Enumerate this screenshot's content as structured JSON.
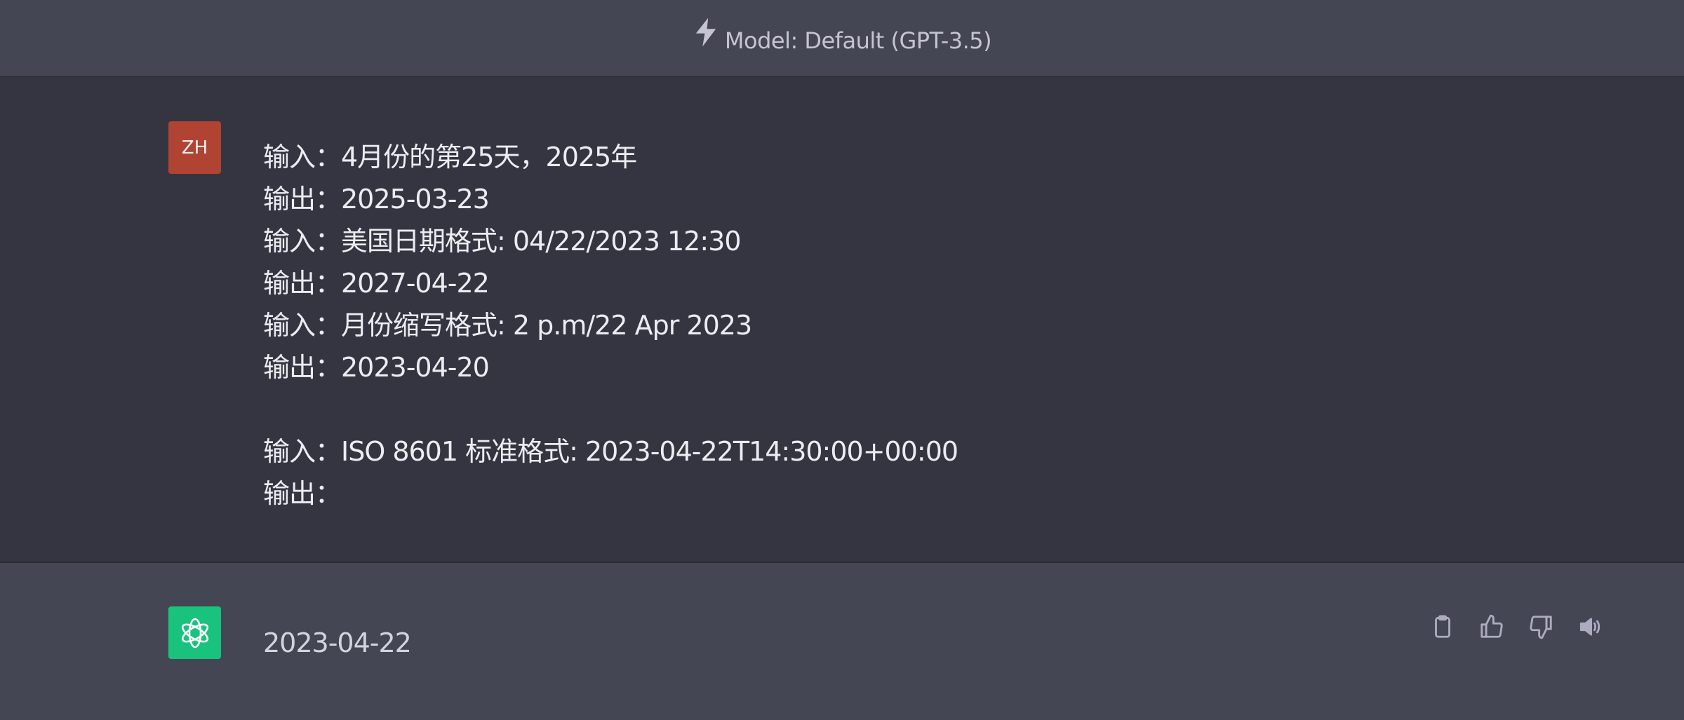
{
  "header": {
    "model_label": "Model: Default (GPT-3.5)"
  },
  "user_message": {
    "avatar_initials": "ZH",
    "lines": [
      "输入：4月份的第25天，2025年",
      "输出：2025-03-23",
      "输入：美国日期格式: 04/22/2023 12:30",
      "输出：2027-04-22",
      "输入：月份缩写格式: 2 p.m/22 Apr 2023",
      "输出：2023-04-20",
      "",
      "输入：ISO 8601 标准格式: 2023-04-22T14:30:00+00:00",
      "输出："
    ]
  },
  "assistant_message": {
    "text": "2023-04-22",
    "actions": [
      "clipboard-icon",
      "thumbs-up-icon",
      "thumbs-down-icon",
      "speaker-icon"
    ]
  },
  "colors": {
    "header_bg": "#444654",
    "user_bg": "#343541",
    "assistant_bg": "#444654",
    "user_avatar": "#b04332",
    "bot_avatar": "#19c37d",
    "text": "#ececf1"
  }
}
